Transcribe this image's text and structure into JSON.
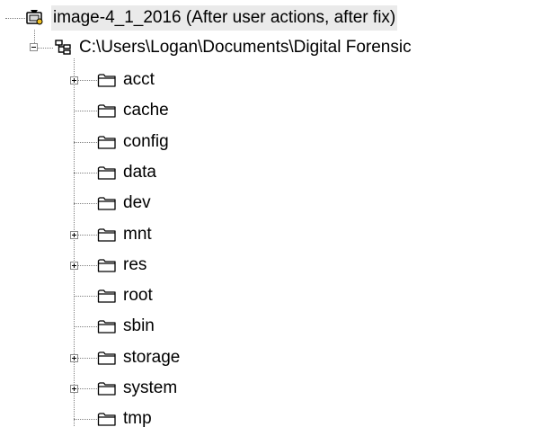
{
  "tree": {
    "root": {
      "label": "image-4_1_2016 (After user actions, after fix)",
      "icon": "evidence-image-icon"
    },
    "partition": {
      "label": "C:\\Users\\Logan\\Documents\\Digital Forensic",
      "icon": "file-system-icon"
    },
    "folders": [
      {
        "label": "acct",
        "expandable": true,
        "icon": "folder-icon"
      },
      {
        "label": "cache",
        "expandable": false,
        "icon": "folder-icon"
      },
      {
        "label": "config",
        "expandable": false,
        "icon": "folder-icon"
      },
      {
        "label": "data",
        "expandable": false,
        "icon": "folder-icon"
      },
      {
        "label": "dev",
        "expandable": false,
        "icon": "folder-icon"
      },
      {
        "label": "mnt",
        "expandable": true,
        "icon": "folder-icon"
      },
      {
        "label": "res",
        "expandable": true,
        "icon": "folder-icon"
      },
      {
        "label": "root",
        "expandable": false,
        "icon": "folder-icon"
      },
      {
        "label": "sbin",
        "expandable": false,
        "icon": "folder-icon"
      },
      {
        "label": "storage",
        "expandable": true,
        "icon": "folder-icon"
      },
      {
        "label": "system",
        "expandable": true,
        "icon": "folder-icon"
      },
      {
        "label": "tmp",
        "expandable": false,
        "icon": "folder-icon"
      }
    ]
  }
}
